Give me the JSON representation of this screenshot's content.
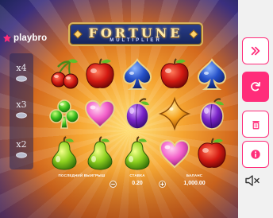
{
  "brand": {
    "name": "playbro",
    "accent": "#ff2d7a"
  },
  "game": {
    "title": "FORTUNE",
    "subtitle": "MULTIPLIER"
  },
  "multipliers": [
    "x4",
    "x3",
    "x2"
  ],
  "grid": [
    [
      "cherry",
      "apple",
      "spade",
      "apple",
      "spade"
    ],
    [
      "club",
      "heart",
      "plum",
      "diamond",
      "plum"
    ],
    [
      "pear",
      "pear",
      "pear",
      "heart",
      "apple"
    ]
  ],
  "info": {
    "last_win_label": "ПОСЛЕДНИЙ ВЫИГРЫШ",
    "last_win_value": "",
    "bet_label": "СТАВКА",
    "bet_value": "0.20",
    "balance_label": "БАЛАНС",
    "balance_value": "1,000.00",
    "bet_decrease_icon": "minus",
    "bet_increase_icon": "plus"
  },
  "sidebar": {
    "turbo_icon": "double-chevron-right-icon",
    "spin_icon": "refresh-icon",
    "paytable_icon": "trash-icon",
    "info_icon": "info-icon",
    "sound_icon": "speaker-muted-icon"
  }
}
